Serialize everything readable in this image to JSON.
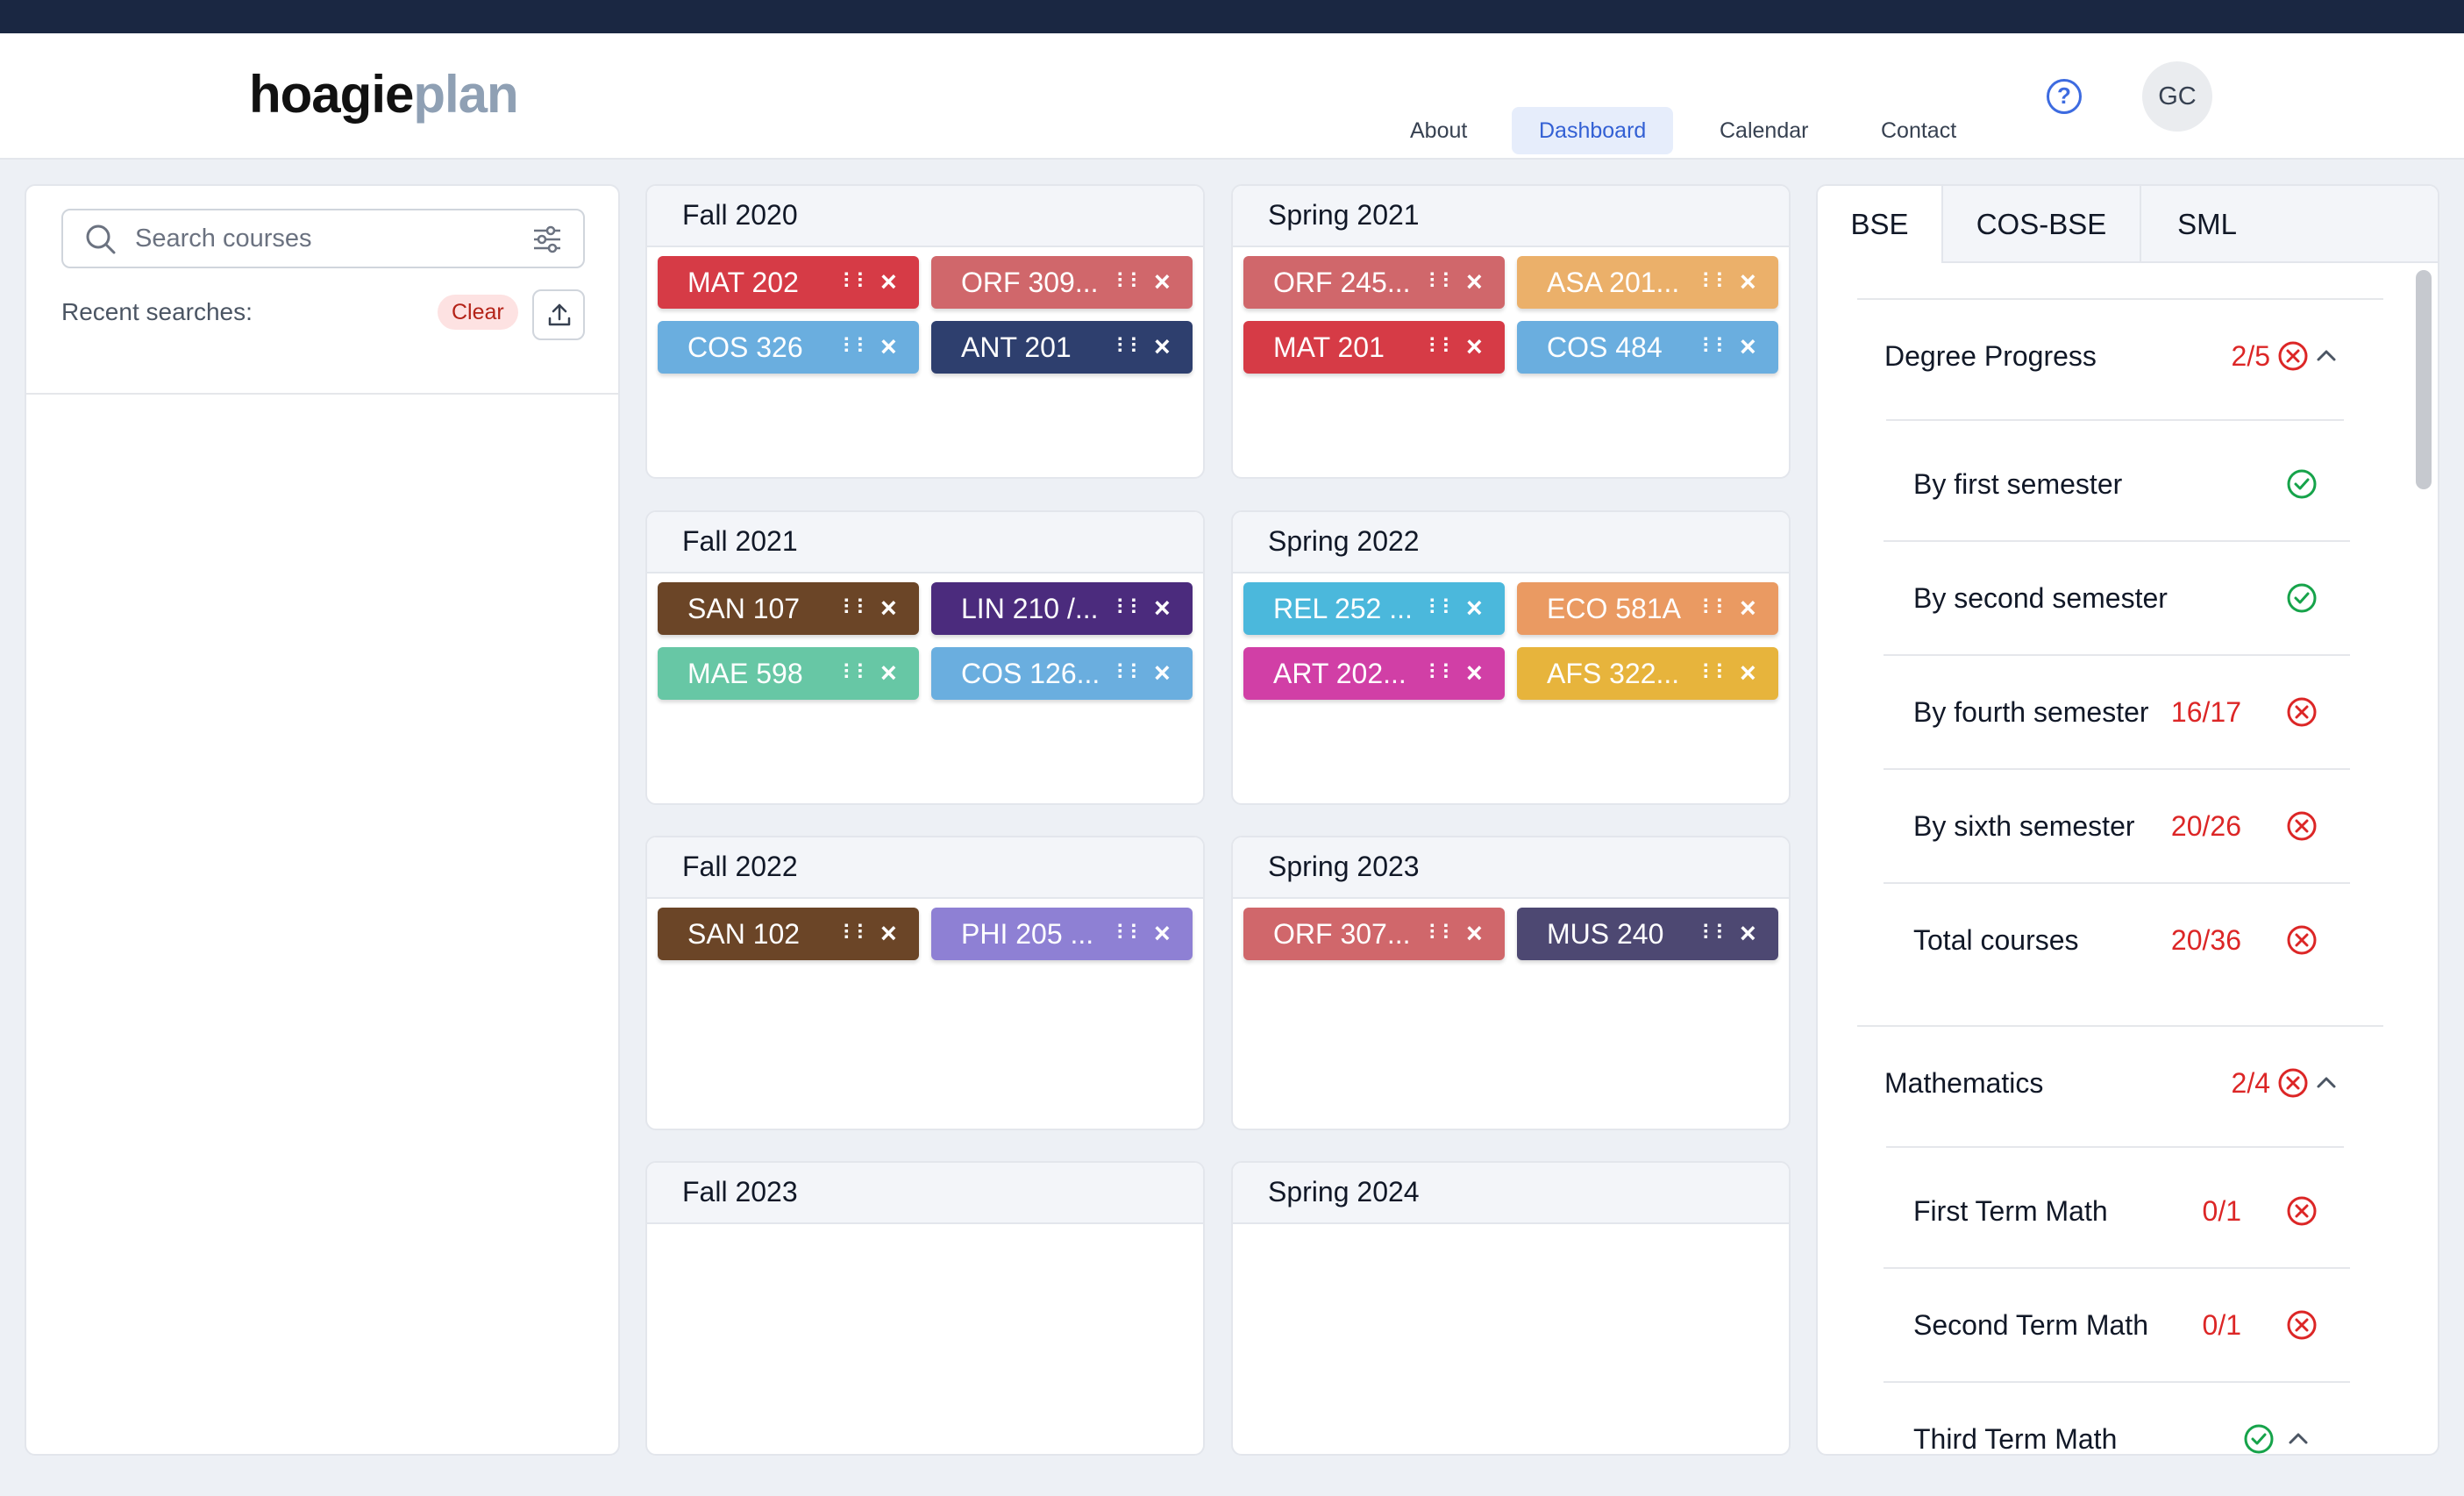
{
  "header": {
    "logo_part1": "hoagie",
    "logo_part2": "plan",
    "nav": [
      "About",
      "Dashboard",
      "Calendar",
      "Contact"
    ],
    "active_nav": "Dashboard",
    "help_glyph": "?",
    "avatar": "GC"
  },
  "search": {
    "placeholder": "Search courses",
    "recent_label": "Recent searches:",
    "clear_label": "Clear"
  },
  "semesters": [
    {
      "title": "Fall 2020",
      "courses": [
        {
          "code": "MAT 202",
          "color": "#d63b46"
        },
        {
          "code": "ORF 309...",
          "color": "#d0676b"
        },
        {
          "code": "COS 326",
          "color": "#6aaedf"
        },
        {
          "code": "ANT 201",
          "color": "#2e3f6e"
        }
      ]
    },
    {
      "title": "Spring 2021",
      "courses": [
        {
          "code": "ORF 245...",
          "color": "#d0676b"
        },
        {
          "code": "ASA 201...",
          "color": "#ebb06a"
        },
        {
          "code": "MAT 201",
          "color": "#d63b46"
        },
        {
          "code": "COS 484",
          "color": "#6aaedf"
        }
      ]
    },
    {
      "title": "Fall 2021",
      "courses": [
        {
          "code": "SAN 107",
          "color": "#6b4527"
        },
        {
          "code": "LIN 210 /...",
          "color": "#4b2b7d"
        },
        {
          "code": "MAE 598",
          "color": "#67c7a5"
        },
        {
          "code": "COS 126...",
          "color": "#6aaedf"
        }
      ]
    },
    {
      "title": "Spring 2022",
      "courses": [
        {
          "code": "REL 252 ...",
          "color": "#4bb8dc"
        },
        {
          "code": "ECO 581A",
          "color": "#ea9a62"
        },
        {
          "code": "ART 202...",
          "color": "#d13fa6"
        },
        {
          "code": "AFS 322...",
          "color": "#e7b43c"
        }
      ]
    },
    {
      "title": "Fall 2022",
      "courses": [
        {
          "code": "SAN 102",
          "color": "#6b4527"
        },
        {
          "code": "PHI 205 ...",
          "color": "#8e80d4"
        }
      ]
    },
    {
      "title": "Spring 2023",
      "courses": [
        {
          "code": "ORF 307...",
          "color": "#d0676b"
        },
        {
          "code": "MUS 240",
          "color": "#4d4872"
        }
      ]
    },
    {
      "title": "Fall 2023",
      "courses": []
    },
    {
      "title": "Spring 2024",
      "courses": []
    }
  ],
  "requirements": {
    "tabs": [
      "BSE",
      "COS-BSE",
      "SML"
    ],
    "active_tab": "BSE",
    "sections": [
      {
        "name": "Degree Progress",
        "value": "2/5",
        "status": "incomplete",
        "items": [
          {
            "label": "By first semester",
            "value": "",
            "status": "complete"
          },
          {
            "label": "By second semester",
            "value": "",
            "status": "complete"
          },
          {
            "label": "By fourth semester",
            "value": "16/17",
            "status": "incomplete"
          },
          {
            "label": "By sixth semester",
            "value": "20/26",
            "status": "incomplete"
          },
          {
            "label": "Total courses",
            "value": "20/36",
            "status": "incomplete"
          }
        ]
      },
      {
        "name": "Mathematics",
        "value": "2/4",
        "status": "incomplete",
        "items": [
          {
            "label": "First Term Math",
            "value": "0/1",
            "status": "incomplete"
          },
          {
            "label": "Second Term Math",
            "value": "0/1",
            "status": "incomplete"
          },
          {
            "label": "Third Term Math",
            "value": "",
            "status": "complete",
            "expandable": true
          }
        ]
      }
    ]
  },
  "colors": {
    "error": "#dc2626",
    "success": "#16a34a",
    "accent": "#3d6be0"
  }
}
